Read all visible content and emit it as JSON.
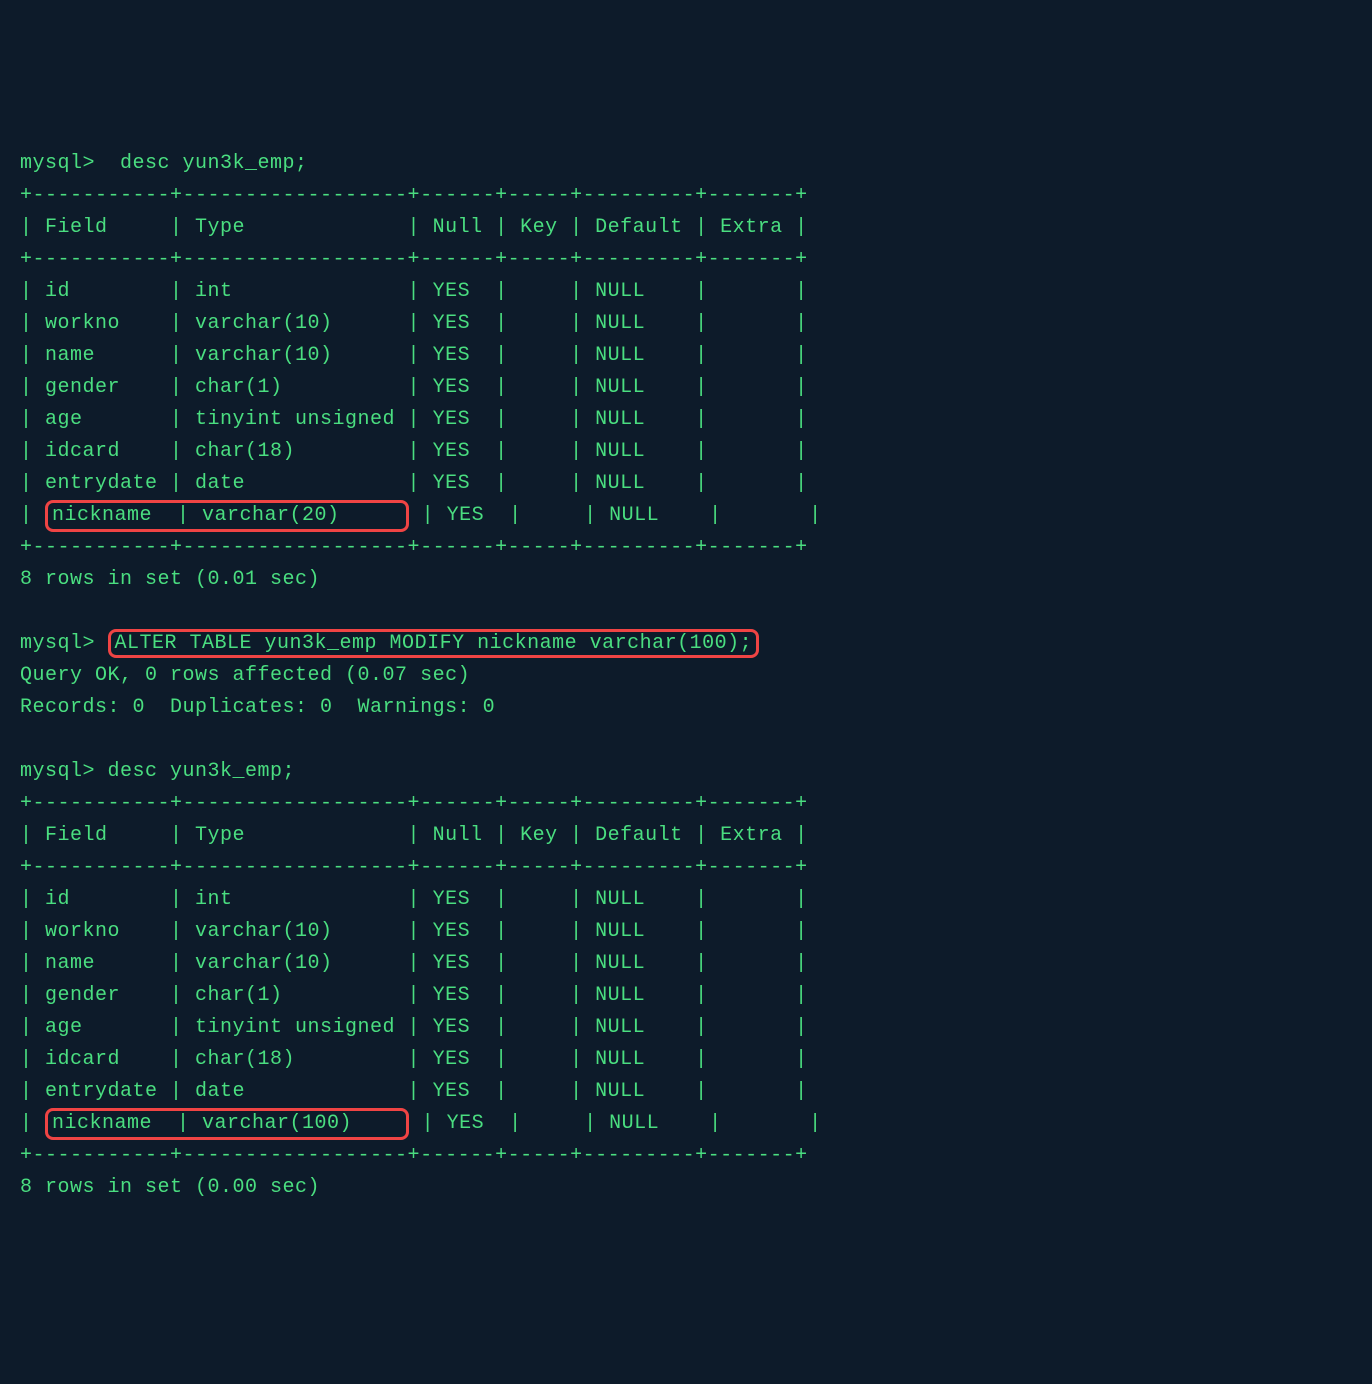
{
  "prompts": {
    "p1": "mysql>  desc yun3k_emp;",
    "p2": "mysql> ",
    "p2_cmd": "ALTER TABLE yun3k_emp MODIFY nickname varchar(100);",
    "p3": "mysql> desc yun3k_emp;"
  },
  "table1": {
    "border_top": "+-----------+------------------+------+-----+---------+-------+",
    "header": "| Field     | Type             | Null | Key | Default | Extra |",
    "border_mid": "+-----------+------------------+------+-----+---------+-------+",
    "row_id": "| id        | int              | YES  |     | NULL    |       |",
    "row_workno": "| workno    | varchar(10)      | YES  |     | NULL    |       |",
    "row_name": "| name      | varchar(10)      | YES  |     | NULL    |       |",
    "row_gender": "| gender    | char(1)          | YES  |     | NULL    |       |",
    "row_age": "| age       | tinyint unsigned | YES  |     | NULL    |       |",
    "row_idcard": "| idcard    | char(18)         | YES  |     | NULL    |       |",
    "row_entrydate": "| entrydate | date             | YES  |     | NULL    |       |",
    "row_nick_pre": "| ",
    "row_nick_hl": "nickname  | varchar(20)     ",
    "row_nick_post": " | YES  |     | NULL    |       |",
    "border_bot": "+-----------+------------------+------+-----+---------+-------+",
    "footer": "8 rows in set (0.01 sec)"
  },
  "alter_result": {
    "line1": "Query OK, 0 rows affected (0.07 sec)",
    "line2": "Records: 0  Duplicates: 0  Warnings: 0"
  },
  "table2": {
    "border_top": "+-----------+------------------+------+-----+---------+-------+",
    "header": "| Field     | Type             | Null | Key | Default | Extra |",
    "border_mid": "+-----------+------------------+------+-----+---------+-------+",
    "row_id": "| id        | int              | YES  |     | NULL    |       |",
    "row_workno": "| workno    | varchar(10)      | YES  |     | NULL    |       |",
    "row_name": "| name      | varchar(10)      | YES  |     | NULL    |       |",
    "row_gender": "| gender    | char(1)          | YES  |     | NULL    |       |",
    "row_age": "| age       | tinyint unsigned | YES  |     | NULL    |       |",
    "row_idcard": "| idcard    | char(18)         | YES  |     | NULL    |       |",
    "row_entrydate": "| entrydate | date             | YES  |     | NULL    |       |",
    "row_nick_pre": "| ",
    "row_nick_hl": "nickname  | varchar(100)    ",
    "row_nick_post": " | YES  |     | NULL    |       |",
    "border_bot": "+-----------+------------------+------+-----+---------+-------+",
    "footer": "8 rows in set (0.00 sec)"
  }
}
